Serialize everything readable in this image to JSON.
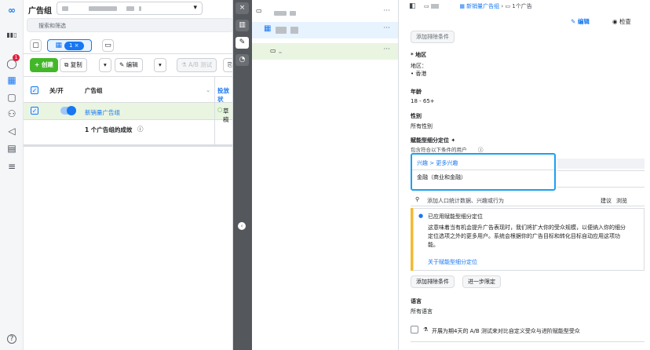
{
  "left_panel": {
    "title": "广告组",
    "search_placeholder": "搜索和筛选",
    "tab_count": "1 ×",
    "toolbar": {
      "create": "+ 创建",
      "copy": "复制",
      "edit": "编辑",
      "ab_test": "A/B 测试"
    },
    "columns": {
      "onoff": "关/开",
      "adset": "广告组",
      "delivery": "投放状"
    },
    "row": {
      "name": "新销量广告组",
      "status": "草稿"
    },
    "summary": "1 个广告组的成效"
  },
  "right_panel": {
    "breadcrumb_blue": "新销量广告组",
    "breadcrumb_tail": "1个广告",
    "edit_label": "编辑",
    "check_label": "检查",
    "add_exclusion_top": "添加排除条件",
    "region_label": "* 地区",
    "region_sub": "地区：",
    "region_value": "• 香港",
    "age_label": "年龄",
    "age_value": "18 - 65+",
    "gender_label": "性别",
    "gender_value": "所有性别",
    "targeting_label": "赋能型细分定位 ✦",
    "targeting_sub": "包含符合以下条件的用户",
    "interest_path": "兴趣 > 更多兴趣",
    "interest_value": "金融（商业和金融）",
    "search_placeholder": "添加人口统计数据、兴趣或行为",
    "suggest": "建议",
    "browse": "浏览",
    "info_title": "已应用赋能型细分定位",
    "info_body_1": "这意味着当有机会提升广告表现时，我们将扩大你的受众规模，以便纳入你的细分",
    "info_body_2": "定位选项之外的更多用户。系统会根据你的广告目标和转化目标自动应用这项功",
    "info_body_3": "能。",
    "info_link": "关于赋能型细分定位",
    "add_exclusion": "添加排除条件",
    "narrow": "进一步限定",
    "language_label": "语言",
    "language_value": "所有语言",
    "ab_line": "开展为期4天的 A/B 测试来对比自定义受众与进阶赋能型受众"
  },
  "rail": {
    "badge": "1",
    "help": "?"
  }
}
